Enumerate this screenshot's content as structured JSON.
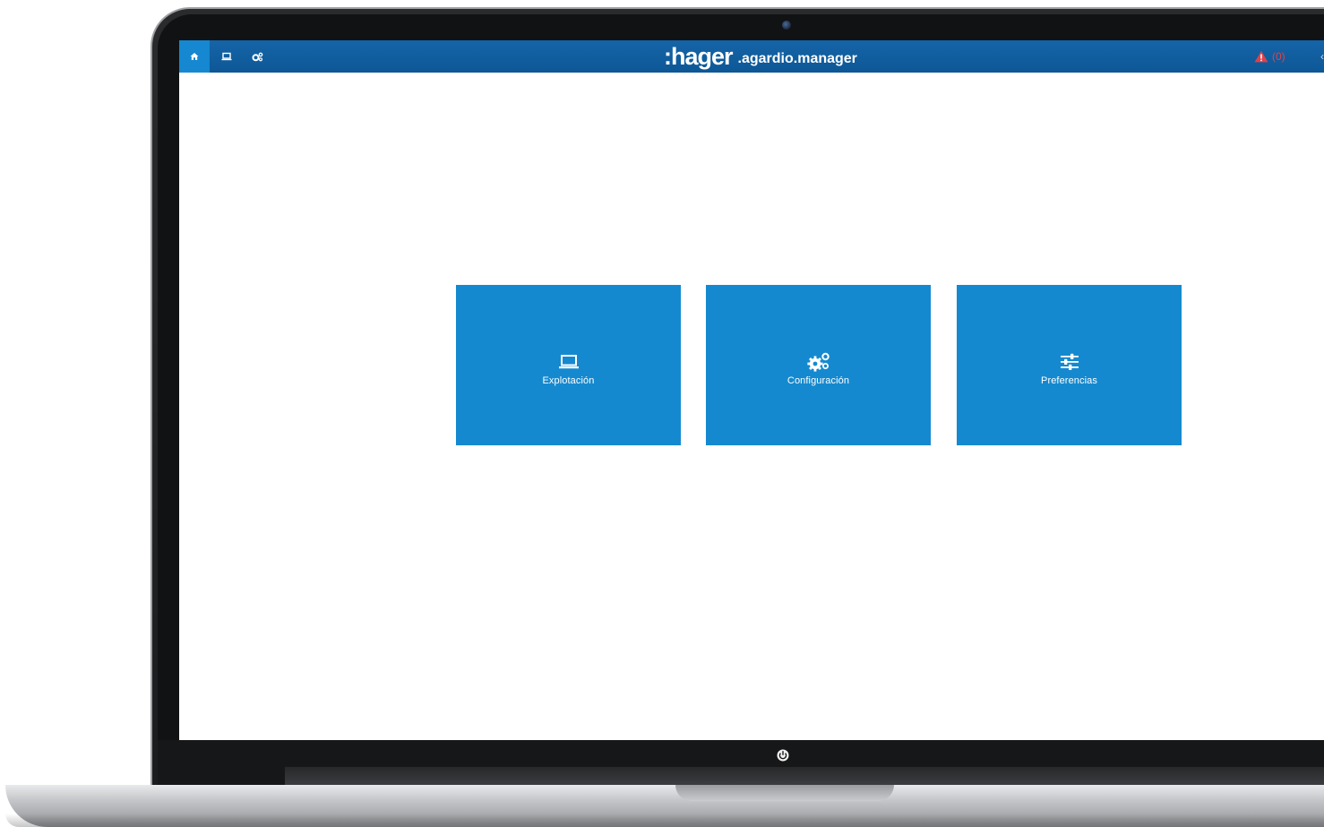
{
  "header": {
    "nav": [
      {
        "icon": "home-icon"
      },
      {
        "icon": "laptop-icon"
      },
      {
        "icon": "gears-icon"
      }
    ],
    "brand_name": ":hager",
    "brand_product": ".agardio.manager",
    "alert_icon": "warning-triangle-icon",
    "alert_count": "(0)"
  },
  "tiles": [
    {
      "label": "Explotación",
      "icon": "laptop-icon"
    },
    {
      "label": "Configuración",
      "icon": "gears-icon"
    },
    {
      "label": "Preferencias",
      "icon": "sliders-icon"
    }
  ],
  "colors": {
    "header_bg": "#0d5796",
    "active_nav": "#1588d1",
    "tile_bg": "#1589cf",
    "alert": "#e0414a"
  },
  "device": {
    "power_icon": "power-icon"
  }
}
